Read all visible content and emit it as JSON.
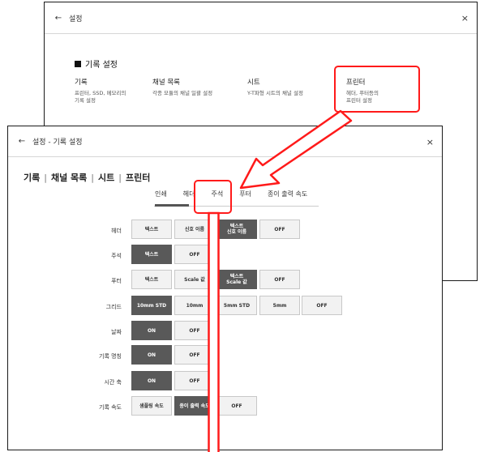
{
  "back_window": {
    "title": "설정",
    "section_title": "기록 설정",
    "categories": [
      {
        "title": "기록",
        "desc": [
          "프린터, SSD, 메모리의",
          "기록 설정"
        ]
      },
      {
        "title": "채널 목록",
        "desc": [
          "각종 모듈의 채널 일괄 설정"
        ]
      },
      {
        "title": "시트",
        "desc": [
          "Y-T파형 시트의 채널 설정"
        ]
      },
      {
        "title": "프린터",
        "desc": [
          "헤더, 푸터등의",
          "프린터 설정"
        ]
      }
    ]
  },
  "front_window": {
    "title": "설정 - 기록 설정",
    "breadcrumbs": [
      "기록",
      "채널 목록",
      "시트",
      "프린터"
    ],
    "tabs": [
      "인쇄",
      "헤더",
      "주석",
      "푸터",
      "종이 출력 속도"
    ],
    "selected_tab": "인쇄",
    "rows": [
      {
        "label": "헤더",
        "options": [
          "텍스트",
          "신호 이름",
          "텍스트\n신호 이름",
          "OFF"
        ],
        "selected": 2
      },
      {
        "label": "주석",
        "options": [
          "텍스트",
          "OFF"
        ],
        "selected": 0
      },
      {
        "label": "푸터",
        "options": [
          "텍스트",
          "Scale 값",
          "텍스트\nScale 값",
          "OFF"
        ],
        "selected": 2
      },
      {
        "label": "그리드",
        "options": [
          "10mm STD",
          "10mm",
          "5mm STD",
          "5mm",
          "OFF"
        ],
        "selected": 0
      },
      {
        "label": "날짜",
        "options": [
          "ON",
          "OFF"
        ],
        "selected": 0
      },
      {
        "label": "기록 명칭",
        "options": [
          "ON",
          "OFF"
        ],
        "selected": 0
      },
      {
        "label": "시간 축",
        "options": [
          "ON",
          "OFF"
        ],
        "selected": 0
      },
      {
        "label": "기록 속도",
        "options": [
          "샘플링 속도",
          "종이 출력 속도",
          "OFF"
        ],
        "selected": 1
      }
    ]
  },
  "colors": {
    "highlight": "#ff1a1a",
    "selected_option": "#595959"
  }
}
